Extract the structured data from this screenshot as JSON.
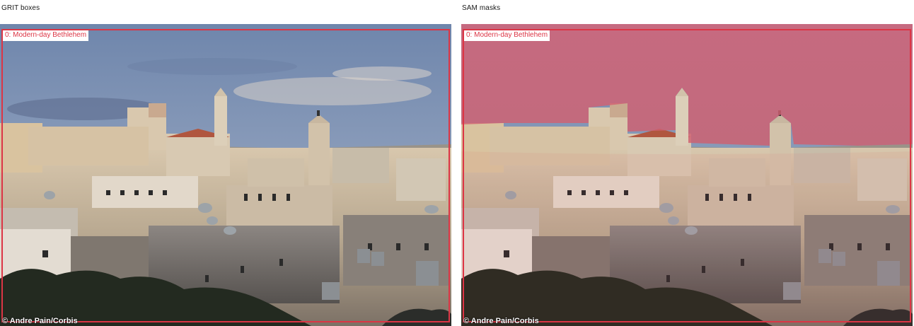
{
  "panels": {
    "left_title": "GRIT boxes",
    "right_title": "SAM masks"
  },
  "detection": {
    "label": "0: Modern-day Bethlehem",
    "box_color": "#dc3545",
    "mask_color": "#e0405a"
  },
  "photo": {
    "credit": "© Andre Pain/Corbis"
  }
}
